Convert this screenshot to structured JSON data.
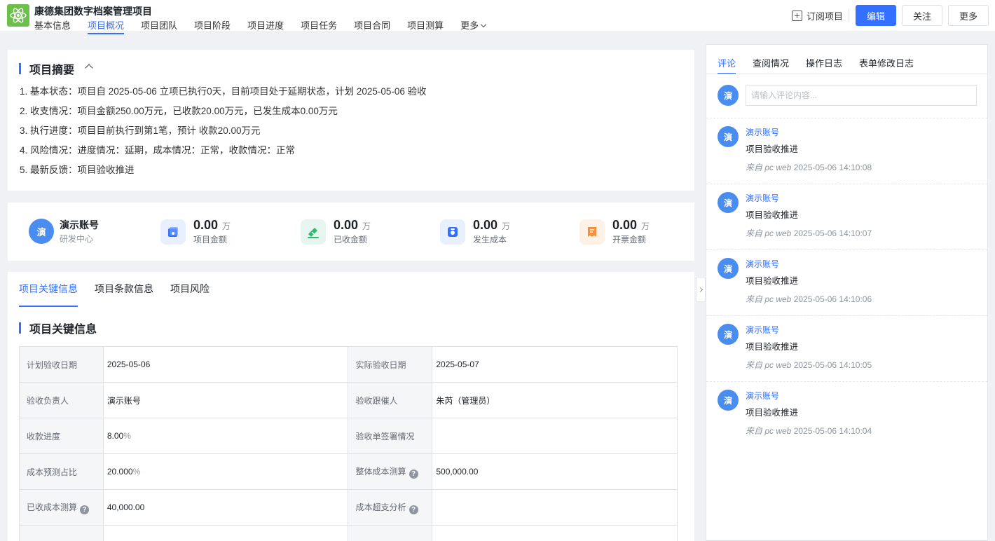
{
  "header": {
    "project_title": "康德集团数字档案管理项目",
    "nav": [
      "基本信息",
      "项目概况",
      "项目团队",
      "项目阶段",
      "项目进度",
      "项目任务",
      "项目合同",
      "项目测算"
    ],
    "nav_more": "更多",
    "active_nav": "项目概况",
    "subscribe_label": "订阅项目",
    "edit_label": "编辑",
    "follow_label": "关注",
    "more_label": "更多",
    "accent_color": "#3370ff"
  },
  "summary": {
    "title": "项目摘要",
    "lines": [
      "1. 基本状态：项目自 2025-05-06 立项已执行0天，目前项目处于延期状态，计划 2025-05-06 验收",
      "2. 收支情况：项目金额250.00万元，已收款20.00万元，已发生成本0.00万元",
      "3. 执行进度：项目目前执行到第1笔，预计 收款20.00万元",
      "4. 风险情况：进度情况：延期，成本情况：正常，收款情况：正常",
      "5. 最新反馈：项目验收推进"
    ]
  },
  "stats": {
    "user": {
      "avatar": "演",
      "name": "演示账号",
      "dept": "研发中心"
    },
    "items": [
      {
        "value": "0.00",
        "unit": "万",
        "label": "项目金额",
        "icon": "wallet-icon",
        "color": "#3370ff"
      },
      {
        "value": "0.00",
        "unit": "万",
        "label": "已收金额",
        "icon": "received-icon",
        "color": "#2fb872"
      },
      {
        "value": "0.00",
        "unit": "万",
        "label": "发生成本",
        "icon": "cost-icon",
        "color": "#3370ff"
      },
      {
        "value": "0.00",
        "unit": "万",
        "label": "开票金额",
        "icon": "invoice-icon",
        "color": "#f5913d"
      }
    ]
  },
  "details": {
    "tabs": [
      "项目关键信息",
      "项目条款信息",
      "项目风险"
    ],
    "section_title": "项目关键信息",
    "rows": [
      {
        "k1": "计划验收日期",
        "v1": "2025-05-06",
        "k2": "实际验收日期",
        "v2": "2025-05-07"
      },
      {
        "k1": "验收负责人",
        "v1": "演示账号",
        "k2": "验收跟催人",
        "v2": "朱芮（管理员）"
      },
      {
        "k1": "收款进度",
        "v1": "8.00",
        "v1_unit": "%",
        "k2": "验收单签署情况",
        "v2": ""
      },
      {
        "k1": "成本预测占比",
        "v1": "20.000",
        "v1_unit": "%",
        "k2": "整体成本测算",
        "v2": "500,000.00"
      },
      {
        "k1": "已收成本测算",
        "v1": "40,000.00",
        "k2": "成本超支分析",
        "v2": ""
      }
    ]
  },
  "right_panel": {
    "tabs": [
      "评论",
      "查阅情况",
      "操作日志",
      "表单修改日志"
    ],
    "avatar": "演",
    "input_placeholder": "请输入评论内容...",
    "comments": [
      {
        "author": "演示账号",
        "text": "项目验收推进",
        "via": "来自 pc web",
        "time": "2025-05-06 14:10:08"
      },
      {
        "author": "演示账号",
        "text": "项目验收推进",
        "via": "来自 pc web",
        "time": "2025-05-06 14:10:07"
      },
      {
        "author": "演示账号",
        "text": "项目验收推进",
        "via": "来自 pc web",
        "time": "2025-05-06 14:10:06"
      },
      {
        "author": "演示账号",
        "text": "项目验收推进",
        "via": "来自 pc web",
        "time": "2025-05-06 14:10:05"
      },
      {
        "author": "演示账号",
        "text": "项目验收推进",
        "via": "来自 pc web",
        "time": "2025-05-06 14:10:04"
      }
    ]
  }
}
